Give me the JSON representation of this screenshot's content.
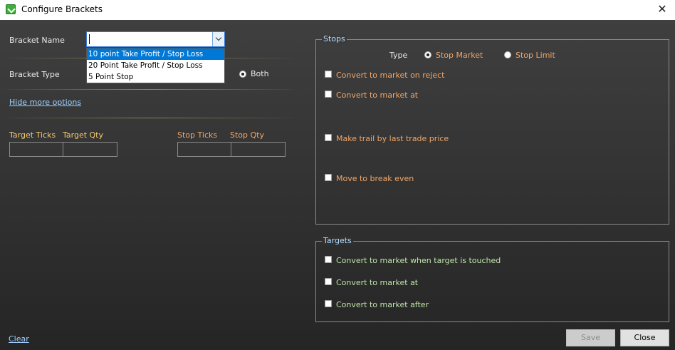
{
  "window": {
    "title": "Configure Brackets",
    "close_glyph": "✕",
    "icon": "app-icon"
  },
  "bracket_name": {
    "label": "Bracket Name",
    "value": "",
    "options": [
      "10 point Take Profit / Stop Loss",
      "20 Point Take Profit / Stop Loss",
      "5 Point Stop"
    ],
    "highlighted_index": 0
  },
  "bracket_type": {
    "label": "Bracket Type",
    "selected_option": "Both"
  },
  "hide_more_options": "Hide more options",
  "targets_grid": {
    "ticks_header": "Target Ticks",
    "qty_header": "Target Qty"
  },
  "stops_grid": {
    "ticks_header": "Stop Ticks",
    "qty_header": "Stop Qty"
  },
  "stops": {
    "legend": "Stops",
    "type_label": "Type",
    "type_options": [
      "Stop Market",
      "Stop Limit"
    ],
    "type_selected": "Stop Market",
    "checkboxes": [
      {
        "label": "Convert to market on reject",
        "checked": false
      },
      {
        "label": "Convert to market at",
        "checked": false
      },
      {
        "label": "Make trail by last trade price",
        "checked": false
      },
      {
        "label": "Move to break even",
        "checked": false
      }
    ]
  },
  "targets": {
    "legend": "Targets",
    "checkboxes": [
      {
        "label": "Convert to market when target is touched",
        "checked": false
      },
      {
        "label": "Convert to market at",
        "checked": false
      },
      {
        "label": "Convert to market after",
        "checked": false
      }
    ]
  },
  "footer": {
    "clear_label": "Clear",
    "save_label": "Save",
    "close_label": "Close"
  },
  "colors": {
    "accent_blue": "#0078d7",
    "legend_blue": "#b3dcff",
    "label_yellow": "#f3c96b",
    "label_orange": "#f0a66a",
    "label_green": "#bfe4a8"
  }
}
